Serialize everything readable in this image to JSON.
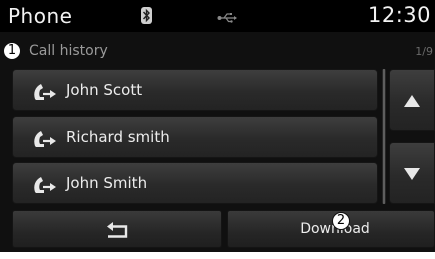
{
  "status_bar": {
    "title": "Phone",
    "clock": "12:30",
    "icons": [
      "bluetooth-icon",
      "usb-icon"
    ]
  },
  "header": {
    "marker": "1",
    "title": "Call history",
    "page_indicator": "1/9"
  },
  "call_list": {
    "items": [
      {
        "name": "John Scott",
        "icon": "outgoing-call-icon"
      },
      {
        "name": "Richard smith",
        "icon": "outgoing-call-icon"
      },
      {
        "name": "John Smith",
        "icon": "outgoing-call-icon"
      }
    ]
  },
  "scroll": {
    "up_icon": "up-arrow-icon",
    "down_icon": "down-arrow-icon"
  },
  "footer": {
    "back_icon": "back-arrow-icon",
    "download_label": "Download",
    "marker": "2"
  },
  "colors": {
    "background": "#101010",
    "button_top": "#3e3e3e",
    "button_bottom": "#232323",
    "text": "#ececec",
    "muted_text": "#9a9a9a"
  }
}
